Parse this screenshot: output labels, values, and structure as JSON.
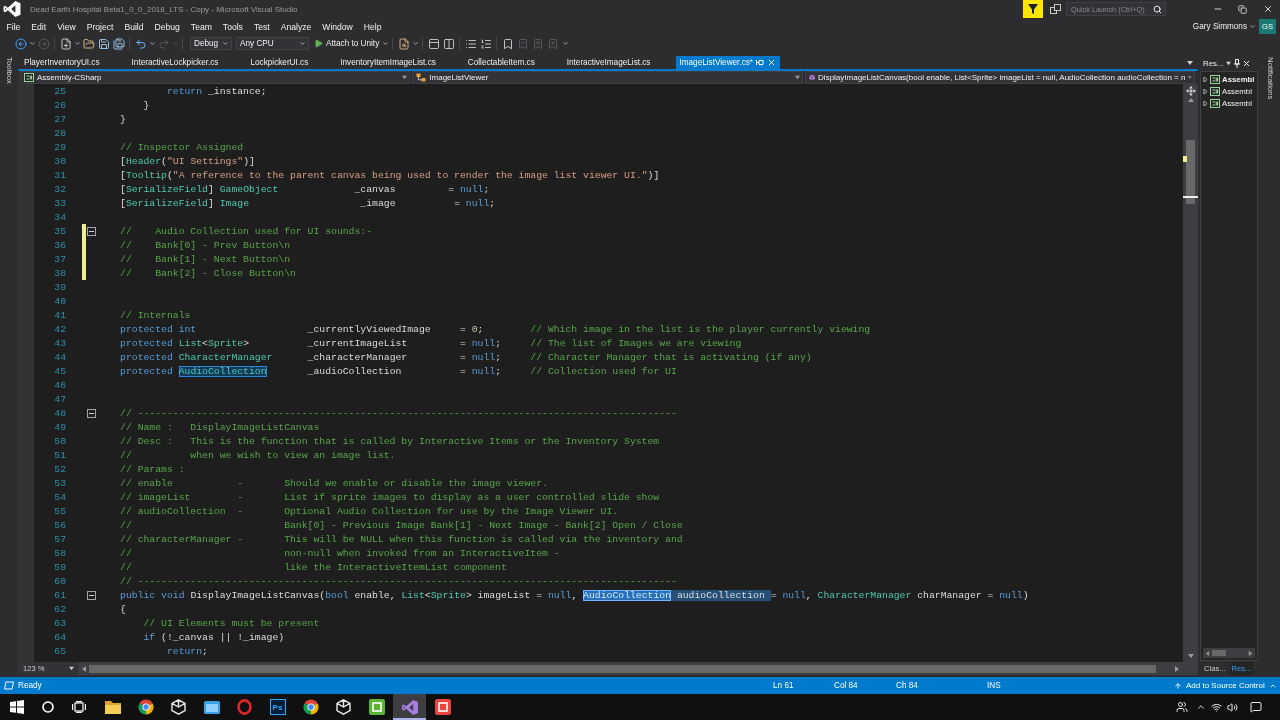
{
  "window": {
    "title": "Dead Earth Hospital Beta1_0_0_2018_LTS - Copy - Microsoft Visual Studio"
  },
  "quick_launch": {
    "placeholder": "Quick Launch (Ctrl+Q)"
  },
  "menu": [
    "File",
    "Edit",
    "View",
    "Project",
    "Build",
    "Debug",
    "Team",
    "Tools",
    "Test",
    "Analyze",
    "Window",
    "Help"
  ],
  "account": {
    "name": "Gary Simmons",
    "initials": "GS"
  },
  "toolbar": {
    "items": [
      {
        "kind": "back",
        "disabled": false
      },
      {
        "kind": "forward",
        "disabled": true
      },
      {
        "kind": "separator"
      },
      {
        "kind": "new",
        "disabled": false
      },
      {
        "kind": "open",
        "disabled": false
      },
      {
        "kind": "save",
        "disabled": false
      },
      {
        "kind": "save_all",
        "disabled": false
      },
      {
        "kind": "separator"
      },
      {
        "kind": "undo",
        "disabled": false
      },
      {
        "kind": "redo",
        "disabled": true
      },
      {
        "kind": "separator"
      },
      {
        "kind": "dropdown",
        "value": "Debug"
      },
      {
        "kind": "dropdown",
        "value": "Any CPU"
      },
      {
        "kind": "run",
        "label": "Attach to Unity"
      },
      {
        "kind": "separator"
      },
      {
        "kind": "find",
        "disabled": false
      },
      {
        "kind": "separator"
      },
      {
        "kind": "panel",
        "disabled": false
      },
      {
        "kind": "panels",
        "disabled": false
      },
      {
        "kind": "separator"
      },
      {
        "kind": "comment",
        "disabled": false
      },
      {
        "kind": "uncomment",
        "disabled": false
      },
      {
        "kind": "separator"
      },
      {
        "kind": "bookmark",
        "disabled": false
      },
      {
        "kind": "bookmark_prev",
        "disabled": true
      },
      {
        "kind": "bookmark_next",
        "disabled": true
      },
      {
        "kind": "bookmark_clear",
        "disabled": true
      },
      {
        "kind": "overflow"
      }
    ]
  },
  "toolbox": {
    "label": "Toolbox"
  },
  "tabs": [
    {
      "label": "PlayerInventoryUI.cs",
      "selected": false
    },
    {
      "label": "InteractiveLockpicker.cs",
      "selected": false
    },
    {
      "label": "LockpickerUI.cs",
      "selected": false
    },
    {
      "label": "InventoryItemImageList.cs",
      "selected": false
    },
    {
      "label": "CollectableItem.cs",
      "selected": false
    },
    {
      "label": "InteractiveImageList.cs",
      "selected": false
    },
    {
      "label": "ImageListViewer.cs*",
      "selected": true
    }
  ],
  "navigation_bar": {
    "project": "Assembly-CSharp",
    "type": "ImageListViewer",
    "member": "DisplayImageListCanvas(bool enable, List<Sprite> imageList = null, AudioCollection audioCollection = n"
  },
  "editor": {
    "lines": [
      {
        "number": "25",
        "modified": false,
        "tokens": [
          {
            "kind": "keyword",
            "text": "            return"
          },
          {
            "kind": "plain",
            "text": " _instance;"
          }
        ]
      },
      {
        "number": "26",
        "modified": false,
        "tokens": [
          {
            "kind": "plain",
            "text": "        }"
          }
        ]
      },
      {
        "number": "27",
        "modified": false,
        "tokens": [
          {
            "kind": "plain",
            "text": "    }"
          }
        ]
      },
      {
        "number": "28",
        "modified": false
      },
      {
        "number": "29",
        "modified": false,
        "tokens": [
          {
            "kind": "comment",
            "text": "    // Inspector Assigned"
          }
        ]
      },
      {
        "number": "30",
        "modified": false,
        "tokens": [
          {
            "kind": "plain",
            "text": "    ["
          },
          {
            "kind": "type",
            "text": "Header"
          },
          {
            "kind": "plain",
            "text": "("
          },
          {
            "kind": "string",
            "text": "\"UI Settings\""
          },
          {
            "kind": "plain",
            "text": ")]"
          }
        ]
      },
      {
        "number": "31",
        "modified": false,
        "tokens": [
          {
            "kind": "plain",
            "text": "    ["
          },
          {
            "kind": "type",
            "text": "Tooltip"
          },
          {
            "kind": "plain",
            "text": "("
          },
          {
            "kind": "string",
            "text": "\"A reference to the parent canvas being used to render the image list viewer UI.\""
          },
          {
            "kind": "plain",
            "text": ")]"
          }
        ]
      },
      {
        "number": "32",
        "modified": false,
        "tokens": [
          {
            "kind": "plain",
            "text": "    ["
          },
          {
            "kind": "type",
            "text": "SerializeField"
          },
          {
            "kind": "plain",
            "text": "] "
          },
          {
            "kind": "type",
            "text": "GameObject"
          },
          {
            "kind": "plain",
            "text": "             _canvas         = "
          },
          {
            "kind": "keyword",
            "text": "null"
          },
          {
            "kind": "plain",
            "text": ";"
          }
        ]
      },
      {
        "number": "33",
        "modified": false,
        "tokens": [
          {
            "kind": "plain",
            "text": "    ["
          },
          {
            "kind": "type",
            "text": "SerializeField"
          },
          {
            "kind": "plain",
            "text": "] "
          },
          {
            "kind": "type",
            "text": "Image"
          },
          {
            "kind": "plain",
            "text": "                   _image          = "
          },
          {
            "kind": "keyword",
            "text": "null"
          },
          {
            "kind": "plain",
            "text": ";"
          }
        ]
      },
      {
        "number": "34",
        "modified": false
      },
      {
        "number": "35",
        "modified": true,
        "expanded": true,
        "tokens": [
          {
            "kind": "comment",
            "text": "    //    Audio Collection used for UI sounds:-"
          }
        ]
      },
      {
        "number": "36",
        "modified": true,
        "tokens": [
          {
            "kind": "comment",
            "text": "    //    Bank[0] - Prev Button\\n"
          }
        ]
      },
      {
        "number": "37",
        "modified": true,
        "tokens": [
          {
            "kind": "comment",
            "text": "    //    Bank[1] - Next Button\\n"
          }
        ]
      },
      {
        "number": "38",
        "modified": true,
        "tokens": [
          {
            "kind": "comment",
            "text": "    //    Bank[2] - Close Button\\n"
          }
        ]
      },
      {
        "number": "39",
        "modified": false
      },
      {
        "number": "40",
        "modified": false
      },
      {
        "number": "41",
        "modified": false,
        "tokens": [
          {
            "kind": "comment",
            "text": "    // Internals"
          }
        ]
      },
      {
        "number": "42",
        "modified": false,
        "tokens": [
          {
            "kind": "keyword",
            "text": "    protected int"
          },
          {
            "kind": "plain",
            "text": "                   _currentlyViewedImage     = "
          },
          {
            "kind": "number",
            "text": "0"
          },
          {
            "kind": "plain",
            "text": ";        "
          },
          {
            "kind": "comment",
            "text": "// Which image in the list is the player currently viewing"
          }
        ]
      },
      {
        "number": "43",
        "modified": false,
        "tokens": [
          {
            "kind": "keyword",
            "text": "    protected "
          },
          {
            "kind": "type",
            "text": "List"
          },
          {
            "kind": "plain",
            "text": "<"
          },
          {
            "kind": "type",
            "text": "Sprite"
          },
          {
            "kind": "plain",
            "text": ">          _currentImageList         = "
          },
          {
            "kind": "keyword",
            "text": "null"
          },
          {
            "kind": "plain",
            "text": ";     "
          },
          {
            "kind": "comment",
            "text": "// The list of Images we are viewing"
          }
        ]
      },
      {
        "number": "44",
        "modified": false,
        "tokens": [
          {
            "kind": "keyword",
            "text": "    protected "
          },
          {
            "kind": "type",
            "text": "CharacterManager"
          },
          {
            "kind": "plain",
            "text": "      _characterManager         = "
          },
          {
            "kind": "keyword",
            "text": "null"
          },
          {
            "kind": "plain",
            "text": ";     "
          },
          {
            "kind": "comment",
            "text": "// Character Manager that is activating (if any)"
          }
        ]
      },
      {
        "number": "45",
        "modified": false,
        "tokens": [
          {
            "kind": "keyword",
            "text": "    protected "
          },
          {
            "kind": "reference",
            "text": "AudioCollection"
          },
          {
            "kind": "plain",
            "text": "       _audioCollection          = "
          },
          {
            "kind": "keyword",
            "text": "null"
          },
          {
            "kind": "plain",
            "text": ";     "
          },
          {
            "kind": "comment",
            "text": "// Collection used for UI"
          }
        ]
      },
      {
        "number": "46",
        "modified": false
      },
      {
        "number": "47",
        "modified": false
      },
      {
        "number": "48",
        "modified": false,
        "expanded": true,
        "tokens": [
          {
            "kind": "comment",
            "text": "    // --------------------------------------------------------------------------------------------"
          }
        ]
      },
      {
        "number": "49",
        "modified": false,
        "tokens": [
          {
            "kind": "comment",
            "text": "    // Name :   DisplayImageListCanvas"
          }
        ]
      },
      {
        "number": "50",
        "modified": false,
        "tokens": [
          {
            "kind": "comment",
            "text": "    // Desc :   This is the function that is called by Interactive Items or the Inventory System"
          }
        ]
      },
      {
        "number": "51",
        "modified": false,
        "tokens": [
          {
            "kind": "comment",
            "text": "    //          when we wish to view an image list."
          }
        ]
      },
      {
        "number": "52",
        "modified": false,
        "tokens": [
          {
            "kind": "comment",
            "text": "    // Params :"
          }
        ]
      },
      {
        "number": "53",
        "modified": false,
        "tokens": [
          {
            "kind": "comment",
            "text": "    // enable           -       Should we enable or disable the image viewer."
          }
        ]
      },
      {
        "number": "54",
        "modified": false,
        "tokens": [
          {
            "kind": "comment",
            "text": "    // imageList        -       List if sprite images to display as a user controlled slide show"
          }
        ]
      },
      {
        "number": "55",
        "modified": false,
        "tokens": [
          {
            "kind": "comment",
            "text": "    // audioCollection  -       Optional Audio Collection for use by the Image Viewer UI."
          }
        ]
      },
      {
        "number": "56",
        "modified": false,
        "tokens": [
          {
            "kind": "comment",
            "text": "    //                          Bank[0] - Previous Image Bank[1] - Next Image - Bank[2] Open / Close"
          }
        ]
      },
      {
        "number": "57",
        "modified": false,
        "tokens": [
          {
            "kind": "comment",
            "text": "    // characterManager -       This will be NULL when this function is called via the inventory and"
          }
        ]
      },
      {
        "number": "58",
        "modified": false,
        "tokens": [
          {
            "kind": "comment",
            "text": "    //                          non-null when invoked from an InteractiveItem -"
          }
        ]
      },
      {
        "number": "59",
        "modified": false,
        "tokens": [
          {
            "kind": "comment",
            "text": "    //                          like the InteractiveItemList component"
          }
        ]
      },
      {
        "number": "60",
        "modified": false,
        "tokens": [
          {
            "kind": "comment",
            "text": "    // --------------------------------------------------------------------------------------------"
          }
        ]
      },
      {
        "number": "61",
        "modified": false,
        "expanded": true,
        "tokens": [
          {
            "kind": "keyword",
            "text": "    public void"
          },
          {
            "kind": "plain",
            "text": " DisplayImageListCanvas("
          },
          {
            "kind": "keyword",
            "text": "bool"
          },
          {
            "kind": "plain",
            "text": " enable, "
          },
          {
            "kind": "type",
            "text": "List"
          },
          {
            "kind": "plain",
            "text": "<"
          },
          {
            "kind": "type",
            "text": "Sprite"
          },
          {
            "kind": "plain",
            "text": "> imageList = "
          },
          {
            "kind": "keyword",
            "text": "null"
          },
          {
            "kind": "plain",
            "text": ", "
          },
          {
            "kind": "selected_reference",
            "text": "AudioCollection"
          },
          {
            "kind": "selection",
            "text": " audioCollection "
          },
          {
            "kind": "plain",
            "text": "= "
          },
          {
            "kind": "keyword",
            "text": "null"
          },
          {
            "kind": "plain",
            "text": ", "
          },
          {
            "kind": "type",
            "text": "CharacterManager"
          },
          {
            "kind": "plain",
            "text": " charManager = "
          },
          {
            "kind": "keyword",
            "text": "null"
          },
          {
            "kind": "plain",
            "text": ")"
          }
        ]
      },
      {
        "number": "62",
        "modified": false,
        "tokens": [
          {
            "kind": "plain",
            "text": "    {"
          }
        ]
      },
      {
        "number": "63",
        "modified": false,
        "tokens": [
          {
            "kind": "comment",
            "text": "        // UI Elements must be present"
          }
        ]
      },
      {
        "number": "64",
        "modified": false,
        "tokens": [
          {
            "kind": "keyword",
            "text": "        if"
          },
          {
            "kind": "plain",
            "text": " (!_canvas || !_image)"
          }
        ]
      },
      {
        "number": "65",
        "modified": false,
        "tokens": [
          {
            "kind": "keyword",
            "text": "            return"
          },
          {
            "kind": "plain",
            "text": ";"
          }
        ]
      }
    ],
    "zoom": "123 %"
  },
  "resource_view": {
    "title": "Res...",
    "items": [
      {
        "label": "Assembl",
        "startup": true,
        "expanded": false
      },
      {
        "label": "Assembl",
        "startup": false,
        "expanded": false
      },
      {
        "label": "Assembl",
        "startup": false,
        "expanded": false
      }
    ],
    "tabs": [
      {
        "label": "Clas...",
        "selected": false
      },
      {
        "label": "Res...",
        "selected": true
      }
    ]
  },
  "notifications": {
    "label": "Notifications"
  },
  "status_bar": {
    "message": "Ready",
    "line": "Ln 61",
    "column": "Col 84",
    "character": "Ch 84",
    "mode": "INS",
    "source_control": "Add to Source Control"
  },
  "taskbar": {
    "apps": [
      {
        "kind": "folder",
        "active": false
      },
      {
        "kind": "wheel",
        "active": false
      },
      {
        "kind": "cube",
        "active": false
      },
      {
        "kind": "panel",
        "active": false
      },
      {
        "kind": "ring",
        "active": false
      },
      {
        "kind": "tile",
        "label": "Ps",
        "color": "#001e36",
        "active": false
      },
      {
        "kind": "wheel",
        "active": false
      },
      {
        "kind": "cube",
        "active": false
      },
      {
        "kind": "frame",
        "color": "#5cb531",
        "active": false
      },
      {
        "kind": "ribbon",
        "active": true
      },
      {
        "kind": "frame",
        "color": "#e8453c",
        "active": false
      }
    ]
  }
}
